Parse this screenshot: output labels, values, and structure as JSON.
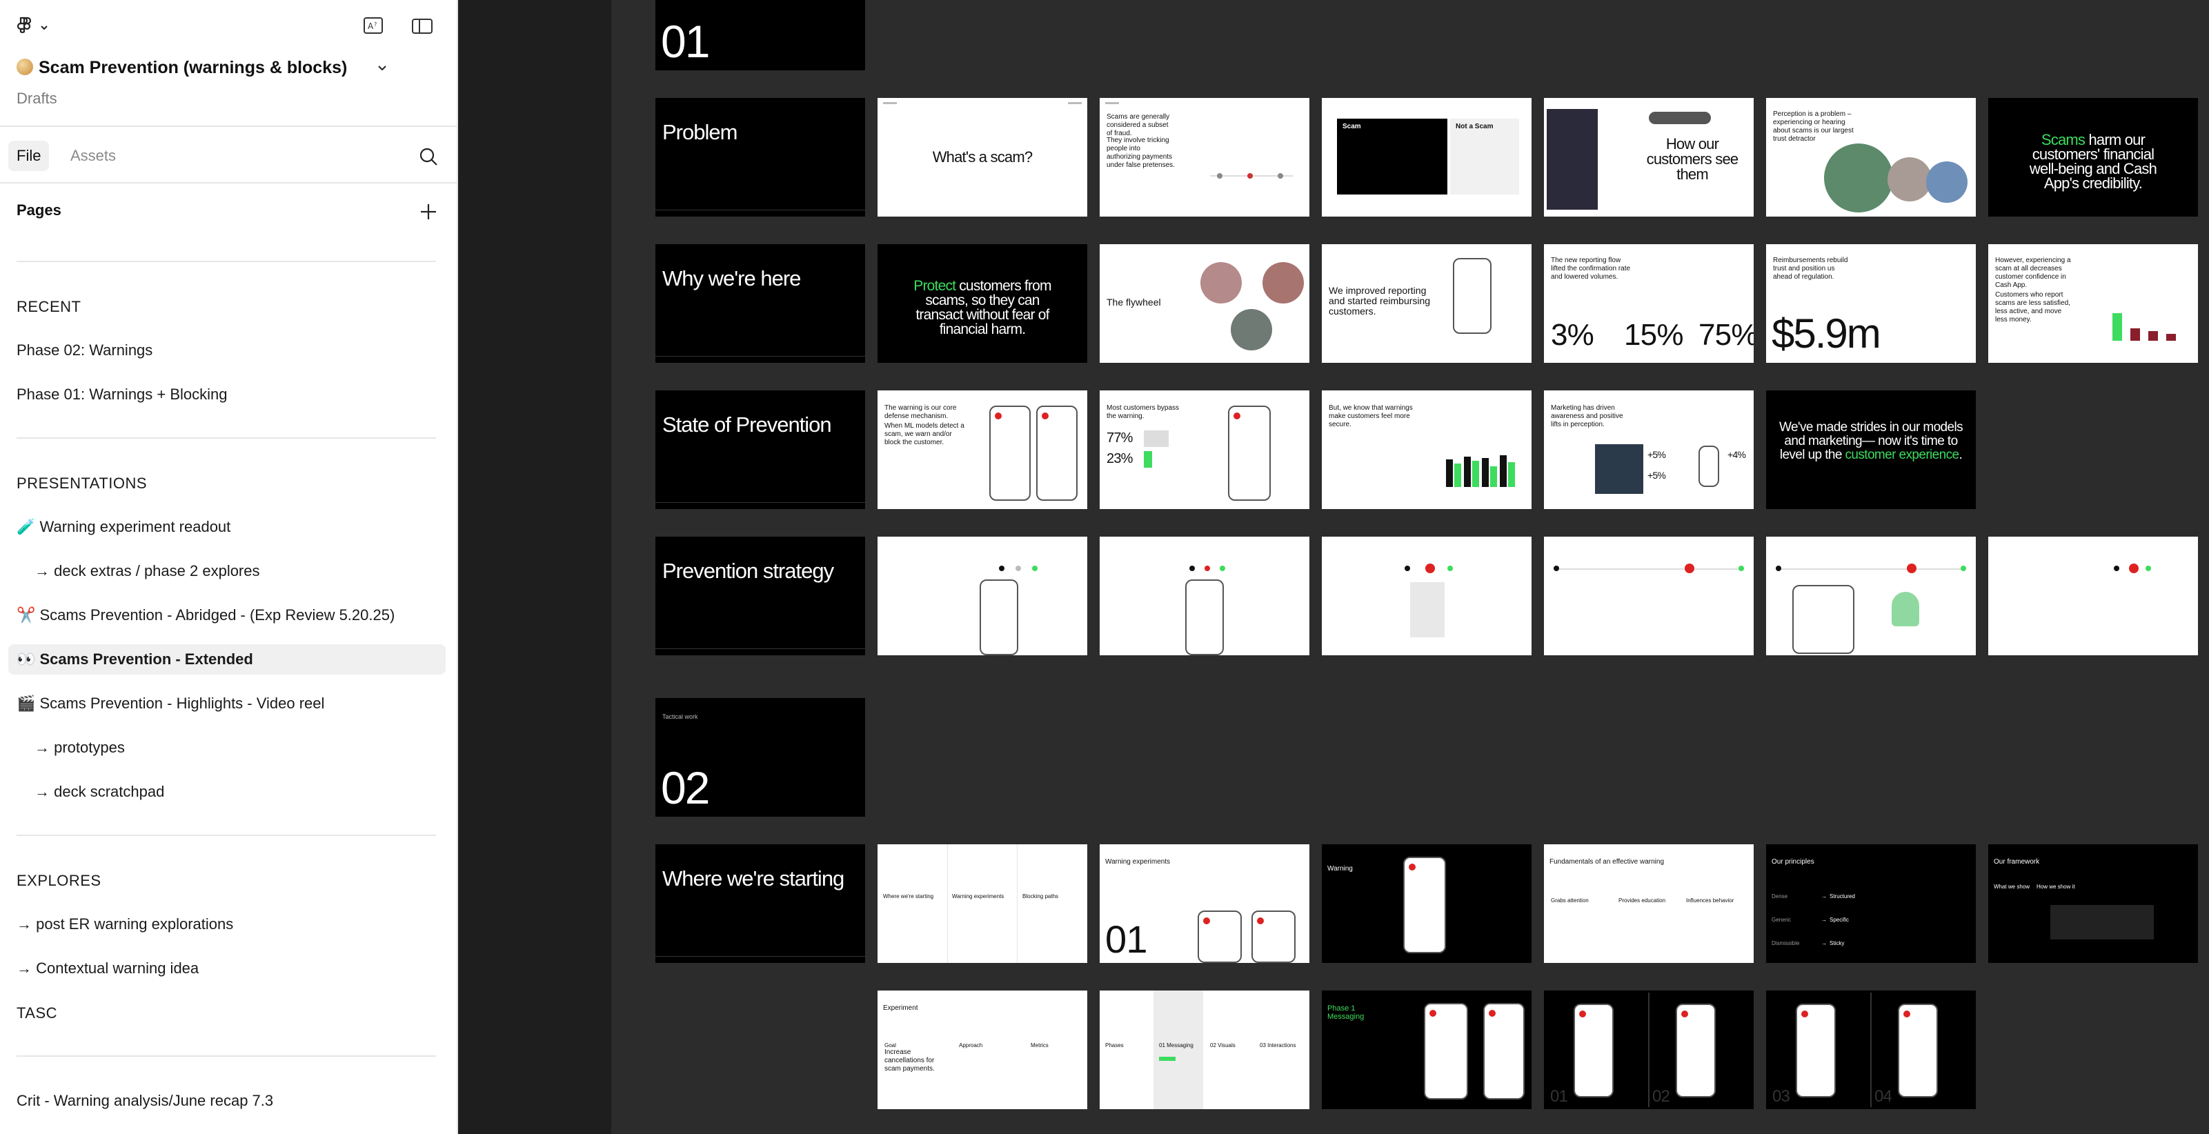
{
  "sidebar": {
    "project_title": "Scam Prevention (warnings & blocks)",
    "project_location": "Drafts",
    "tabs": {
      "file": "File",
      "assets": "Assets"
    },
    "pages_label": "Pages",
    "recent": {
      "heading": "RECENT",
      "items": [
        "Phase 02: Warnings",
        "Phase 01:  Warnings + Blocking"
      ]
    },
    "presentations": {
      "heading": "PRESENTATIONS",
      "items": [
        "🧪 Warning experiment readout",
        "→ deck extras / phase 2 explores",
        "✂️ Scams Prevention - Abridged - (Exp Review 5.20.25)",
        "👀 Scams Prevention - Extended",
        "🎬 Scams Prevention - Highlights - Video reel",
        "→ prototypes",
        "→ deck scratchpad"
      ]
    },
    "explores": {
      "heading": "EXPLORES",
      "items": [
        "→ post ER warning explorations",
        "→ Contextual warning idea"
      ]
    },
    "tasc": {
      "heading": "TASC"
    },
    "last_item": "Crit - Warning analysis/June recap 7.3"
  },
  "canvas": {
    "sections": {
      "s01": "01",
      "problem": "Problem",
      "why": "Why we're here",
      "state": "State of Prevention",
      "strategy": "Prevention strategy",
      "tactical_label": "Tactical work",
      "s02": "02",
      "starting": "Where we're starting"
    },
    "slides": {
      "whats_scam": "What's a scam?",
      "scams_subset": "Scams are generally considered a subset of fraud.",
      "scams_involve": "They involve tricking people into authorizing payments under false pretenses.",
      "scam": "Scam",
      "not_scam": "Not a Scam",
      "how_customers": "How our customers see them",
      "perception": "Perception is a problem – experiencing or hearing about scams is our largest trust detractor",
      "scams_harm_1": "Scams",
      "scams_harm_2": "harm our customers' financial well-being and Cash App's credibility.",
      "protect_1": "Protect",
      "protect_2": "customers from scams, so they can transact without fear of financial harm.",
      "flywheel": "The flywheel",
      "improved_reporting": "We improved reporting and started reimbursing customers.",
      "new_reporting": "The new reporting flow lifted the confirmation rate and lowered volumes.",
      "stat_3": "3%",
      "stat_15": "15%",
      "stat_75": "75%",
      "reimburse": "Reimbursements rebuild trust and position us ahead of regulation.",
      "stat_59m": "$5.9m",
      "however": "However, experiencing a scam at all decreases customer confidence in Cash App.",
      "customers_report": "Customers who report scams are less satisfied, less active, and move less money.",
      "warning_core": "The warning is our core defense mechanism.",
      "ml_models": "When ML models detect a scam, we warn and/or block the customer.",
      "most_bypass": "Most customers bypass the warning.",
      "stat_77": "77%",
      "stat_23": "23%",
      "but_we_know": "But, we know that warnings make customers feel more secure.",
      "marketing": "Marketing has driven awareness and positive lifts in perception.",
      "stat_plus5a": "+5%",
      "stat_plus5b": "+5%",
      "stat_plus4": "+4%",
      "strides_1": "We've made strides in our models and marketing— now it's time to level up the",
      "strides_2": "customer experience",
      "strides_3": ".",
      "where_starting": "Where we're starting",
      "warning_experiments": "Warning experiments",
      "blocking_paths": "Blocking paths",
      "warning_experiments_title": "Warning experiments",
      "big_01": "01",
      "warning": "Warning",
      "fundamentals": "Fundamentals of an effective warning",
      "grabs_attention": "Grabs attention",
      "provides_education": "Provides education",
      "influences_behavior": "Influences behavior",
      "our_principles": "Our principles",
      "p_dense": "Dense",
      "p_generic": "Generic",
      "p_dismissible": "Dismissible",
      "p_structured": "Structured",
      "p_specific": "Specific",
      "p_sticky": "Sticky",
      "our_framework": "Our framework",
      "what_we_show": "What we show",
      "how_we_show": "How we show it",
      "experiment": "Experiment",
      "goal": "Goal",
      "goal_text": "Increase cancellations for scam payments.",
      "approach": "Approach",
      "metrics": "Metrics",
      "phases": "Phases",
      "messaging": "01 Messaging",
      "visuals": "02 Visuals",
      "interactions": "03 Interactions",
      "phase1": "Phase 1",
      "phase1_sub": "Messaging",
      "n01": "01",
      "n02": "02",
      "n03": "03",
      "n04": "04"
    }
  }
}
